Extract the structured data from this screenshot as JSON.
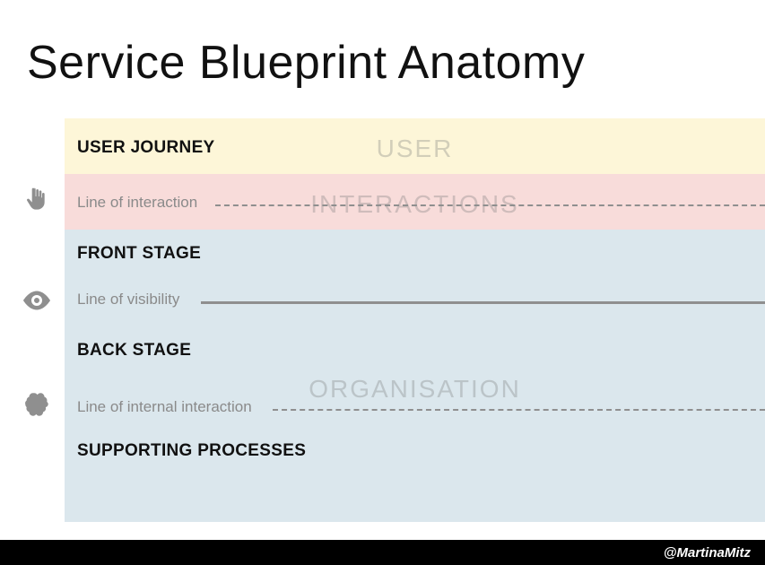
{
  "title": "Service Blueprint Anatomy",
  "rows": {
    "user_journey": "USER JOURNEY",
    "front_stage": "FRONT STAGE",
    "back_stage": "BACK STAGE",
    "supporting": "SUPPORTING PROCESSES"
  },
  "lines": {
    "interaction": "Line of interaction",
    "visibility": "Line of visibility",
    "internal": "Line of internal interaction"
  },
  "watermarks": {
    "user": "USER",
    "interactions": "INTERACTIONS",
    "organisation": "ORGANISATION"
  },
  "icons": {
    "hand": "hand-icon",
    "eye": "eye-icon",
    "brain": "brain-icon"
  },
  "footer": "@MartinaMitz"
}
